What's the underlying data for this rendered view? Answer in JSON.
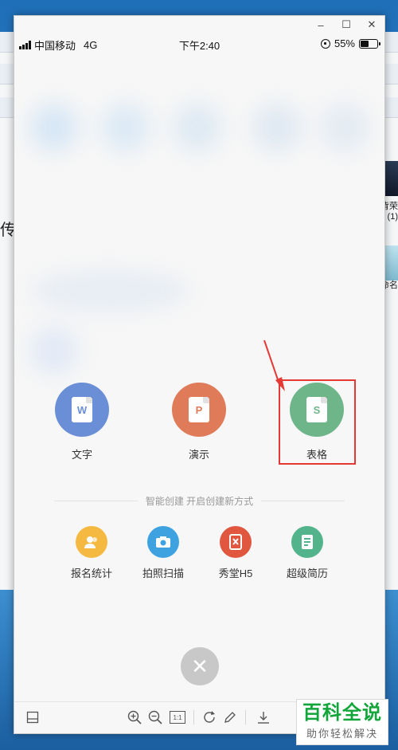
{
  "window": {
    "controls": {
      "minimize": "–",
      "maximize": "☐",
      "close": "✕"
    }
  },
  "status_bar": {
    "carrier": "中国移动",
    "network": "4G",
    "time": "下午2:40",
    "battery": "55%",
    "battery_level": 0.55
  },
  "create_options": [
    {
      "label": "文字",
      "icon": "word-doc-icon",
      "color": "#6b8fd6",
      "letter": "W"
    },
    {
      "label": "演示",
      "icon": "presentation-doc-icon",
      "color": "#e07b5a",
      "letter": "P"
    },
    {
      "label": "表格",
      "icon": "spreadsheet-doc-icon",
      "color": "#6fb58a",
      "letter": "S"
    }
  ],
  "smart_create": {
    "text": "智能创建  开启创建新方式"
  },
  "tools": [
    {
      "label": "报名统计",
      "icon": "people-icon",
      "color": "#f5b942"
    },
    {
      "label": "拍照扫描",
      "icon": "camera-icon",
      "color": "#3ea2e0"
    },
    {
      "label": "秀堂H5",
      "icon": "h5-icon",
      "color": "#e0563e"
    },
    {
      "label": "超级简历",
      "icon": "resume-icon",
      "color": "#53b48c"
    }
  ],
  "close_button": {
    "label": "✕"
  },
  "toolbar": {
    "icons": [
      "layout-icon",
      "zoom-in-icon",
      "zoom-out-icon",
      "actual-size-icon",
      "rotate-icon",
      "edit-icon",
      "download-icon"
    ],
    "actual_size_label": "1:1"
  },
  "background": {
    "left_text": "传",
    "right_labels": [
      "背荣",
      "(1)",
      "命名"
    ]
  },
  "watermark": {
    "title": "百科全说",
    "subtitle": "助你轻松解决"
  }
}
